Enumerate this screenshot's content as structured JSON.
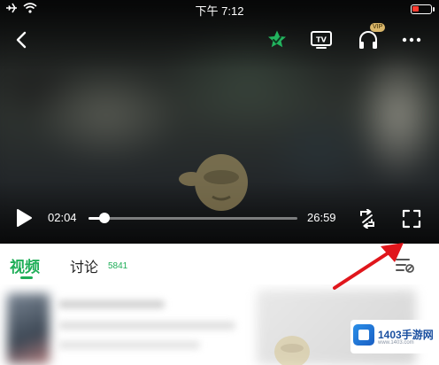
{
  "status_bar": {
    "time": "下午 7:12"
  },
  "player": {
    "current_time": "02:04",
    "duration": "26:59",
    "progress_fraction": 0.077,
    "vip_badge": "VIP",
    "icons": [
      "back-icon",
      "favorite-star-icon",
      "tv-cast-icon",
      "headphones-icon",
      "more-icon",
      "play-icon",
      "loop-shuffle-icon",
      "fullscreen-icon"
    ]
  },
  "tabs": {
    "video_label": "视频",
    "discuss_label": "讨论",
    "discuss_count": "5841"
  },
  "watermark_logo": {
    "title": "1403手游网",
    "subtitle": "www.1403.com"
  },
  "colors": {
    "accent": "#1fae58",
    "annotation_arrow": "#e0161c"
  }
}
